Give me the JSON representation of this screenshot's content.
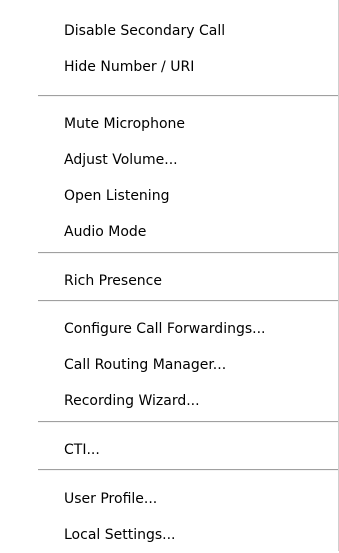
{
  "menu": {
    "groups": [
      {
        "items": [
          "Disable Secondary Call",
          "Hide Number / URI"
        ]
      },
      {
        "items": [
          "Mute Microphone",
          "Adjust Volume...",
          "Open Listening",
          "Audio Mode"
        ]
      },
      {
        "items": [
          "Rich Presence"
        ]
      },
      {
        "items": [
          "Configure Call Forwardings...",
          "Call Routing Manager...",
          "Recording Wizard..."
        ]
      },
      {
        "items": [
          "CTI..."
        ]
      },
      {
        "items": [
          "User Profile...",
          "Local Settings..."
        ]
      }
    ]
  }
}
